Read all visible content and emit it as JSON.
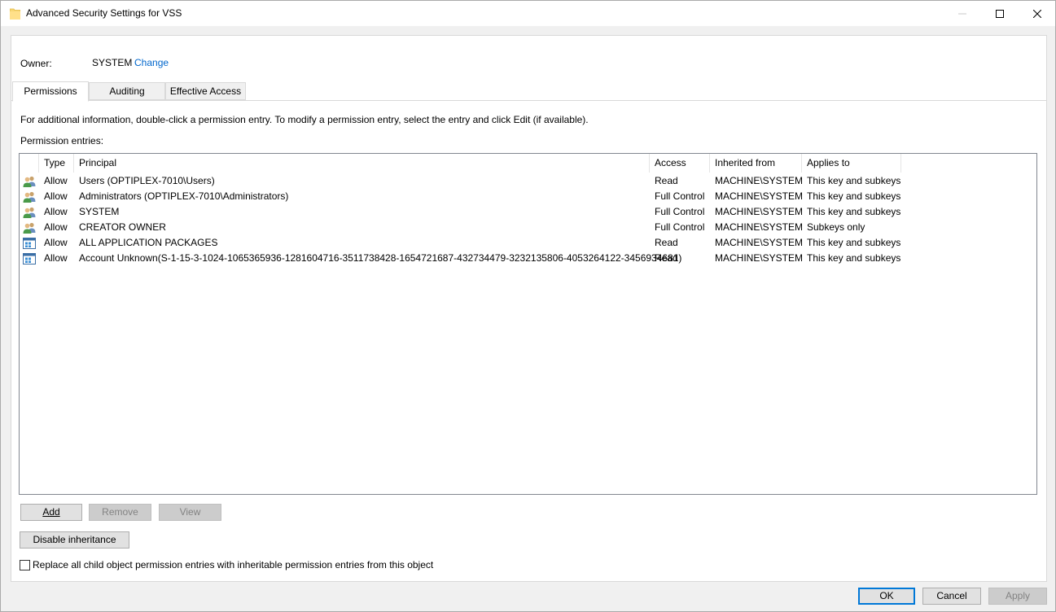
{
  "window": {
    "title": "Advanced Security Settings for VSS",
    "controls": [
      "minimize-icon",
      "maximize-icon",
      "close-icon"
    ]
  },
  "owner": {
    "label": "Owner:",
    "value": "SYSTEM",
    "change_link": "Change"
  },
  "tabs": [
    {
      "label": "Permissions",
      "active": true
    },
    {
      "label": "Auditing",
      "active": false
    },
    {
      "label": "Effective Access",
      "active": false
    }
  ],
  "info_text": "For additional information, double-click a permission entry. To modify a permission entry, select the entry and click Edit (if available).",
  "entries_label": "Permission entries:",
  "columns": [
    "Type",
    "Principal",
    "Access",
    "Inherited from",
    "Applies to"
  ],
  "rows": [
    {
      "icon": "users-group-icon",
      "type": "Allow",
      "principal": "Users (OPTIPLEX-7010\\Users)",
      "access": "Read",
      "inherited": "MACHINE\\SYSTEM",
      "applies": "This key and subkeys"
    },
    {
      "icon": "users-group-icon",
      "type": "Allow",
      "principal": "Administrators (OPTIPLEX-7010\\Administrators)",
      "access": "Full Control",
      "inherited": "MACHINE\\SYSTEM",
      "applies": "This key and subkeys"
    },
    {
      "icon": "users-group-icon",
      "type": "Allow",
      "principal": "SYSTEM",
      "access": "Full Control",
      "inherited": "MACHINE\\SYSTEM",
      "applies": "This key and subkeys"
    },
    {
      "icon": "users-group-icon",
      "type": "Allow",
      "principal": "CREATOR OWNER",
      "access": "Full Control",
      "inherited": "MACHINE\\SYSTEM",
      "applies": "Subkeys only"
    },
    {
      "icon": "app-package-icon",
      "type": "Allow",
      "principal": "ALL APPLICATION PACKAGES",
      "access": "Read",
      "inherited": "MACHINE\\SYSTEM",
      "applies": "This key and subkeys"
    },
    {
      "icon": "app-package-icon",
      "type": "Allow",
      "principal": "Account Unknown(S-1-15-3-1024-1065365936-1281604716-3511738428-1654721687-432734479-3232135806-4053264122-3456934681)",
      "access": "Read",
      "inherited": "MACHINE\\SYSTEM",
      "applies": "This key and subkeys"
    }
  ],
  "buttons": {
    "add": "Add",
    "remove": "Remove",
    "view": "View",
    "disable_inheritance": "Disable inheritance",
    "ok": "OK",
    "cancel": "Cancel",
    "apply": "Apply"
  },
  "replace_checkbox": {
    "label": "Replace all child object permission entries with inheritable permission entries from this object",
    "checked": false
  },
  "colors": {
    "link": "#0066cc",
    "primary_border": "#0078d7",
    "disabled_text": "#838383"
  }
}
